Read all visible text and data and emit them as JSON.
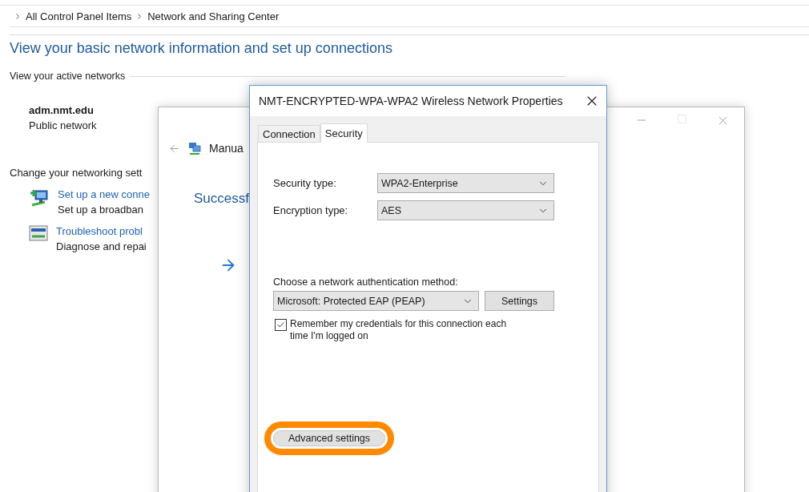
{
  "breadcrumb": [
    "All Control Panel Items",
    "Network and Sharing Center"
  ],
  "heading": "View your basic network information and set up connections",
  "active_networks": {
    "label": "View your active networks",
    "network": {
      "name": "adm.nmt.edu",
      "type": "Public network"
    }
  },
  "change_settings": {
    "label": "Change your networking sett",
    "tasks": [
      {
        "kind": "new-connection",
        "link": "Set up a new conne",
        "description": "Set up a broadban"
      },
      {
        "kind": "troubleshoot",
        "link": "Troubleshoot probl",
        "description": "Diagnose and repai"
      }
    ]
  },
  "wizard_window": {
    "title": "Manua",
    "heading": "Successf"
  },
  "dialog": {
    "title": "NMT-ENCRYPTED-WPA-WPA2 Wireless Network Properties",
    "tabs": [
      {
        "label": "Connection",
        "selected": false
      },
      {
        "label": "Security",
        "selected": true
      }
    ],
    "fields": [
      {
        "label": "Security type:",
        "value": "WPA2-Enterprise"
      },
      {
        "label": "Encryption type:",
        "value": "AES"
      }
    ],
    "auth": {
      "label": "Choose a network authentication method:",
      "method": "Microsoft: Protected EAP (PEAP)",
      "settings_button": "Settings"
    },
    "remember": {
      "label": "Remember my credentials for this connection each time I'm logged on",
      "checked": true
    },
    "advanced_button": {
      "label": "Advanced settings",
      "highlighted": true
    }
  }
}
